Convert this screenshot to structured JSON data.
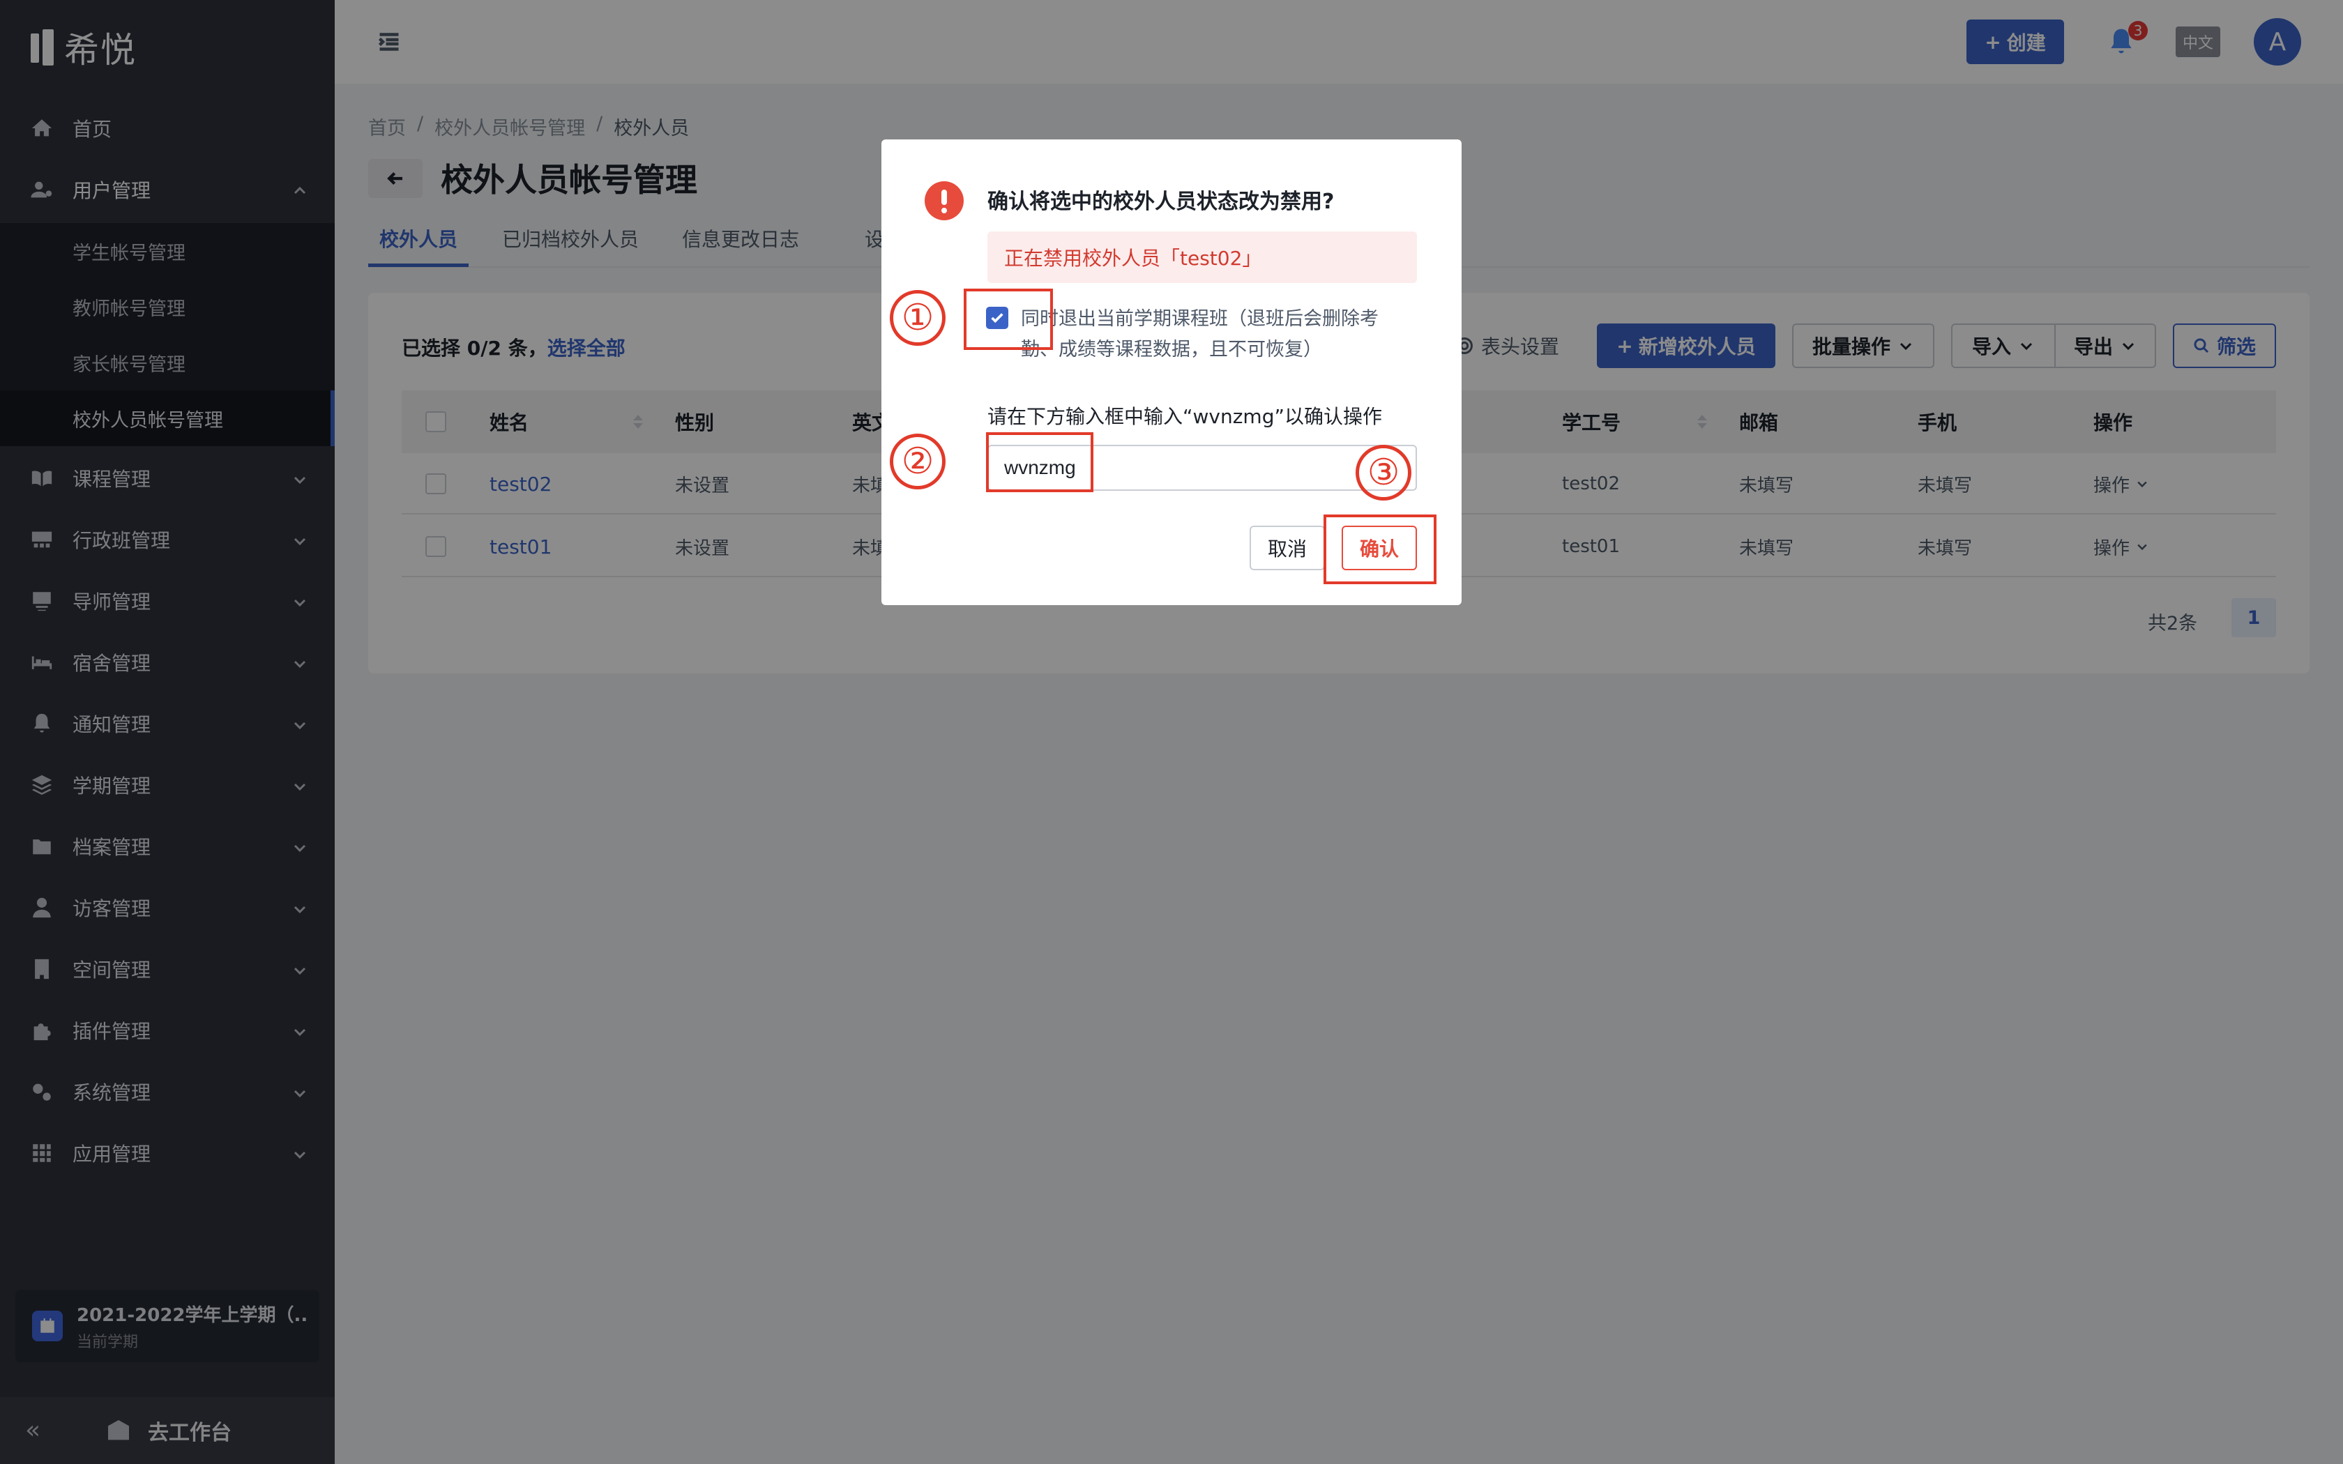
{
  "app": {
    "logo_text": "希悦",
    "create_label": "创建",
    "notification_count": "3",
    "language": "中文",
    "avatar_initial": "A"
  },
  "sidebar": {
    "items": [
      {
        "label": "首页",
        "icon": "home-icon"
      },
      {
        "label": "用户管理",
        "icon": "user-manage-icon",
        "expanded": true
      },
      {
        "label": "课程管理",
        "icon": "book-icon"
      },
      {
        "label": "行政班管理",
        "icon": "class-icon"
      },
      {
        "label": "导师管理",
        "icon": "mentor-icon"
      },
      {
        "label": "宿舍管理",
        "icon": "bed-icon"
      },
      {
        "label": "通知管理",
        "icon": "bell-icon"
      },
      {
        "label": "学期管理",
        "icon": "layers-icon"
      },
      {
        "label": "档案管理",
        "icon": "archive-icon"
      },
      {
        "label": "访客管理",
        "icon": "visitor-icon"
      },
      {
        "label": "空间管理",
        "icon": "building-icon"
      },
      {
        "label": "插件管理",
        "icon": "puzzle-icon"
      },
      {
        "label": "系统管理",
        "icon": "gears-icon"
      },
      {
        "label": "应用管理",
        "icon": "grid-icon"
      }
    ],
    "sub_items": [
      {
        "label": "学生帐号管理"
      },
      {
        "label": "教师帐号管理"
      },
      {
        "label": "家长帐号管理"
      },
      {
        "label": "校外人员帐号管理",
        "active": true
      }
    ],
    "term": {
      "title": "2021-2022学年上学期（...",
      "subtitle": "当前学期"
    },
    "workbench_label": "去工作台",
    "collapse_glyph": "«"
  },
  "page": {
    "breadcrumb": [
      "首页",
      "校外人员帐号管理",
      "校外人员"
    ],
    "breadcrumb_sep": "/",
    "title": "校外人员帐号管理",
    "tabs": [
      {
        "label": "校外人员",
        "active": true
      },
      {
        "label": "已归档校外人员"
      },
      {
        "label": "信息更改日志"
      },
      {
        "label": "设"
      }
    ]
  },
  "toolbar": {
    "selected_text": "已选择 0/2 条，",
    "select_all": "选择全部",
    "column_settings": "表头设置",
    "add_button": "新增校外人员",
    "batch_button": "批量操作",
    "import_button": "导入",
    "export_button": "导出",
    "filter_button": "筛选"
  },
  "table": {
    "columns": [
      "姓名",
      "性别",
      "英文",
      "学工号",
      "邮箱",
      "手机",
      "操作"
    ],
    "rows": [
      {
        "name": "test02",
        "gender": "未设置",
        "english": "未填",
        "staff_id": "test02",
        "email": "未填写",
        "phone": "未填写",
        "action": "操作"
      },
      {
        "name": "test01",
        "gender": "未设置",
        "english": "未填",
        "staff_id": "test01",
        "email": "未填写",
        "phone": "未填写",
        "action": "操作"
      }
    ]
  },
  "pagination": {
    "total": "共2条",
    "current_page": "1"
  },
  "dialog": {
    "title": "确认将选中的校外人员状态改为禁用?",
    "alert": "正在禁用校外人员「test02」",
    "checkbox_checked": true,
    "checkbox_label": "同时退出当前学期课程班（退班后会删除考勤、成绩等课程数据，且不可恢复）",
    "prompt": "请在下方输入框中输入“wvnzmg”以确认操作",
    "input_value": "wvnzmg",
    "cancel_label": "取消",
    "confirm_label": "确认"
  },
  "annotations": {
    "step1": "①",
    "step2": "②",
    "step3": "③",
    "color": "#e23a2a"
  },
  "colors": {
    "primary": "#3b63c7",
    "danger": "#e74b3c",
    "sidebar_bg": "#2e323d"
  }
}
